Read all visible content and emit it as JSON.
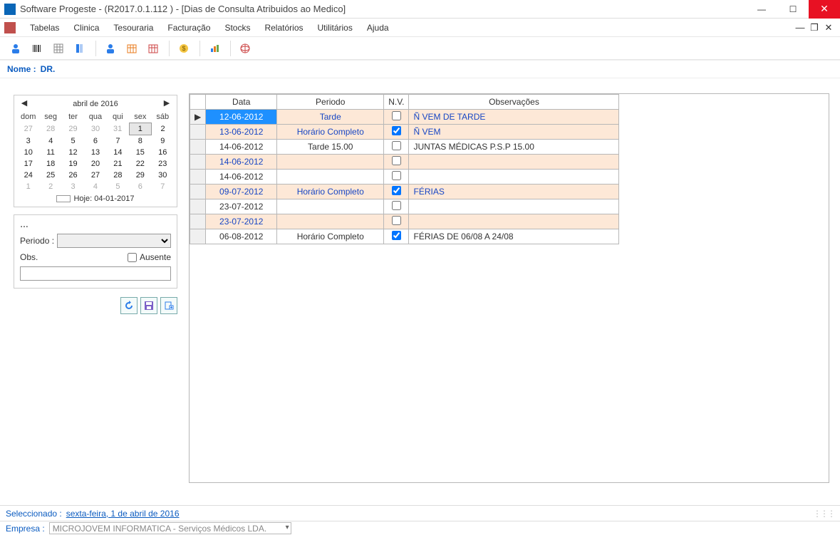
{
  "title": "Software Progeste - (R2017.0.1.112 ) - [Dias de Consulta Atribuidos ao Medico]",
  "menu": [
    "Tabelas",
    "Clinica",
    "Tesouraria",
    "Facturação",
    "Stocks",
    "Relatórios",
    "Utilitários",
    "Ajuda"
  ],
  "name_label": "Nome :",
  "name_value": "DR.",
  "calendar": {
    "title": "abril de 2016",
    "dow": [
      "dom",
      "seg",
      "ter",
      "qua",
      "qui",
      "sex",
      "sáb"
    ],
    "weeks": [
      [
        {
          "d": "27",
          "dim": true
        },
        {
          "d": "28",
          "dim": true
        },
        {
          "d": "29",
          "dim": true
        },
        {
          "d": "30",
          "dim": true
        },
        {
          "d": "31",
          "dim": true
        },
        {
          "d": "1",
          "sel": true
        },
        {
          "d": "2"
        }
      ],
      [
        {
          "d": "3"
        },
        {
          "d": "4"
        },
        {
          "d": "5"
        },
        {
          "d": "6"
        },
        {
          "d": "7"
        },
        {
          "d": "8"
        },
        {
          "d": "9"
        }
      ],
      [
        {
          "d": "10"
        },
        {
          "d": "11"
        },
        {
          "d": "12"
        },
        {
          "d": "13"
        },
        {
          "d": "14"
        },
        {
          "d": "15"
        },
        {
          "d": "16"
        }
      ],
      [
        {
          "d": "17"
        },
        {
          "d": "18"
        },
        {
          "d": "19"
        },
        {
          "d": "20"
        },
        {
          "d": "21"
        },
        {
          "d": "22"
        },
        {
          "d": "23"
        }
      ],
      [
        {
          "d": "24"
        },
        {
          "d": "25"
        },
        {
          "d": "26"
        },
        {
          "d": "27"
        },
        {
          "d": "28"
        },
        {
          "d": "29"
        },
        {
          "d": "30"
        }
      ],
      [
        {
          "d": "1",
          "dim": true
        },
        {
          "d": "2",
          "dim": true
        },
        {
          "d": "3",
          "dim": true
        },
        {
          "d": "4",
          "dim": true
        },
        {
          "d": "5",
          "dim": true
        },
        {
          "d": "6",
          "dim": true
        },
        {
          "d": "7",
          "dim": true
        }
      ]
    ],
    "today": "Hoje: 04-01-2017"
  },
  "filter": {
    "periodo_label": "Periodo :",
    "obs_label": "Obs.",
    "ausente_label": "Ausente"
  },
  "grid": {
    "headers": {
      "data": "Data",
      "periodo": "Periodo",
      "nv": "N.V.",
      "obs": "Observações"
    },
    "rows": [
      {
        "alt": true,
        "sel": true,
        "data": "12-06-2012",
        "periodo": "Tarde",
        "nv": false,
        "obs": "Ñ VEM DE TARDE"
      },
      {
        "alt": true,
        "data": "13-06-2012",
        "periodo": "Horário Completo",
        "nv": true,
        "obs": "Ñ VEM"
      },
      {
        "alt": false,
        "data": "14-06-2012",
        "periodo": "Tarde 15.00",
        "nv": false,
        "obs": "JUNTAS MÉDICAS P.S.P 15.00"
      },
      {
        "alt": true,
        "data": "14-06-2012",
        "periodo": "",
        "nv": false,
        "obs": ""
      },
      {
        "alt": false,
        "data": "14-06-2012",
        "periodo": "",
        "nv": false,
        "obs": ""
      },
      {
        "alt": true,
        "data": "09-07-2012",
        "periodo": "Horário Completo",
        "nv": true,
        "obs": "FÉRIAS"
      },
      {
        "alt": false,
        "data": "23-07-2012",
        "periodo": "",
        "nv": false,
        "obs": ""
      },
      {
        "alt": true,
        "data": "23-07-2012",
        "periodo": "",
        "nv": false,
        "obs": ""
      },
      {
        "alt": false,
        "data": "06-08-2012",
        "periodo": "Horário Completo",
        "nv": true,
        "obs": "FÉRIAS DE 06/08 A 24/08"
      }
    ]
  },
  "status": {
    "label": "Seleccionado :",
    "value": "sexta-feira, 1 de abril de 2016"
  },
  "empresa": {
    "label": "Empresa :",
    "value": "MICROJOVEM INFORMATICA - Serviços Médicos LDA."
  }
}
